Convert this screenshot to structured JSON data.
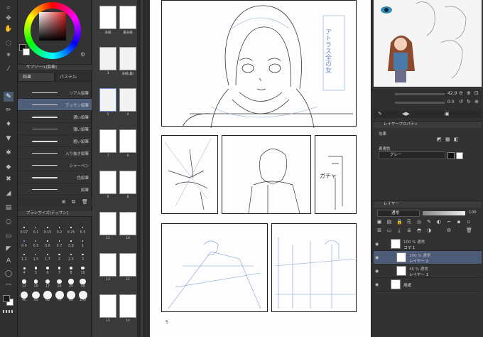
{
  "colors": {
    "main": "#1a1a1a",
    "sub": "#ffffff",
    "accent": "#4f5f7a"
  },
  "tools": [
    {
      "name": "zoom",
      "icon": "magnifier-icon"
    },
    {
      "name": "move",
      "icon": "move-icon"
    },
    {
      "name": "hand",
      "icon": "hand-icon"
    },
    {
      "name": "select",
      "icon": "lasso-icon"
    },
    {
      "name": "auto-select",
      "icon": "wand-icon"
    },
    {
      "name": "eyedropper",
      "icon": "eyedropper-icon"
    },
    {
      "name": "pen",
      "icon": "pen-icon"
    },
    {
      "name": "pencil",
      "icon": "pencil-icon"
    },
    {
      "name": "brush",
      "icon": "brush-icon"
    },
    {
      "name": "airbrush",
      "icon": "airbrush-icon"
    },
    {
      "name": "decoration",
      "icon": "decoration-icon"
    },
    {
      "name": "eraser",
      "icon": "eraser-icon"
    },
    {
      "name": "blend",
      "icon": "blend-icon"
    },
    {
      "name": "fill",
      "icon": "bucket-icon"
    },
    {
      "name": "gradient",
      "icon": "gradient-icon"
    },
    {
      "name": "figure",
      "icon": "ellipse-icon"
    },
    {
      "name": "frame",
      "icon": "frame-icon"
    },
    {
      "name": "ruler",
      "icon": "ruler-icon"
    },
    {
      "name": "text",
      "icon": "text-icon",
      "glyph": "A"
    },
    {
      "name": "balloon",
      "icon": "balloon-icon"
    },
    {
      "name": "correct-line",
      "icon": "correct-line-icon"
    }
  ],
  "subtool": {
    "header": "サブツール[鉛筆]",
    "tabs": [
      "鉛筆",
      "パステル"
    ],
    "brushes": [
      {
        "label": "リアル鉛筆"
      },
      {
        "label": "デッサン鉛筆",
        "selected": true
      },
      {
        "label": "濃い鉛筆"
      },
      {
        "label": "薄い鉛筆"
      },
      {
        "label": "粗い鉛筆"
      },
      {
        "label": "入り抜き鉛筆"
      },
      {
        "label": "シャーペン"
      },
      {
        "label": "色鉛筆"
      },
      {
        "label": "鉛筆"
      }
    ]
  },
  "brush_size": {
    "header": "ブラシサイズ[デッサン]",
    "sizes": [
      "0.07",
      "0.1",
      "0.15",
      "0.2",
      "0.25",
      "0.3",
      "0.4",
      "0.5",
      "0.6",
      "0.7",
      "0.8",
      "1",
      "1.2",
      "1.5",
      "1.7",
      "2",
      "2.5",
      "3",
      "4",
      "5",
      "6",
      "7",
      "8",
      "10",
      "12",
      "15",
      "17",
      "20",
      "25",
      "30",
      "40",
      "50",
      "60",
      "70",
      "80",
      "100"
    ]
  },
  "pages": [
    {
      "label": "表紙"
    },
    {
      "label": "裏表紙"
    },
    {
      "label": "3"
    },
    {
      "label": "表紙(裏)"
    },
    {
      "label": "5"
    },
    {
      "label": "4"
    },
    {
      "label": "7"
    },
    {
      "label": "6"
    },
    {
      "label": "9"
    },
    {
      "label": "8"
    },
    {
      "label": "11"
    },
    {
      "label": "10"
    },
    {
      "label": "13"
    },
    {
      "label": "12"
    },
    {
      "label": "15"
    },
    {
      "label": "14"
    }
  ],
  "canvas": {
    "page_number": "5",
    "title_note": "アトラス全の女",
    "sfx": [
      "ガチャ"
    ]
  },
  "navigator": {
    "zoom": "42.9",
    "angle": "0.0"
  },
  "layer_property": {
    "header": "レイヤープロパティ",
    "effect_label": "効果",
    "color_label": "表現色",
    "color_value": "グレー"
  },
  "layers": {
    "header": "レイヤー",
    "blend": "通常",
    "opacity": "100",
    "items": [
      {
        "name": "コマ 1",
        "meta": "100 % 通常",
        "indent": 0
      },
      {
        "name": "レイヤー 2",
        "meta": "100 % 通常",
        "indent": 1,
        "selected": true
      },
      {
        "name": "レイヤー 1",
        "meta": "46 % 通常",
        "indent": 1
      },
      {
        "name": "用紙",
        "meta": "",
        "indent": 0
      }
    ]
  }
}
